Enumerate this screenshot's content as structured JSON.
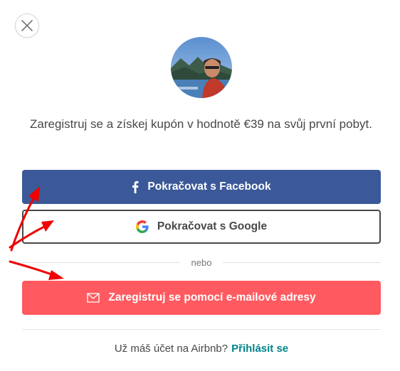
{
  "dialog": {
    "headline": "Zaregistruj se a získej kupón v hodnotě €39 na svůj první pobyt.",
    "facebook_button": "Pokračovat s Facebook",
    "google_button": "Pokračovat s Google",
    "divider_text": "nebo",
    "email_button": "Zaregistruj se pomocí e-mailové adresy",
    "footer_question": "Už máš účet na Airbnb?",
    "footer_login_link": "Přihlásit se"
  },
  "icons": {
    "close": "close-icon",
    "facebook": "facebook-icon",
    "google": "google-icon",
    "email": "envelope-icon"
  },
  "colors": {
    "facebook": "#3B5998",
    "email_button": "#FF5A5F",
    "link": "#008489",
    "annotation_arrows": "#F00000"
  }
}
